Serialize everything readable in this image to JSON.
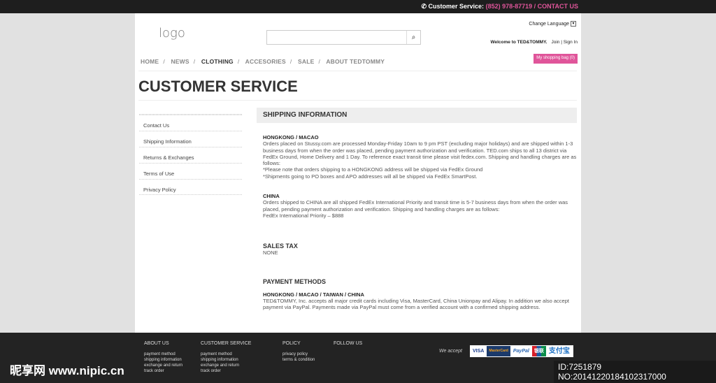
{
  "topbar": {
    "label": "Customer Service:",
    "phone": "(852) 978-87719",
    "sep": " / ",
    "contact": "CONTACT US"
  },
  "header": {
    "logo": "logo",
    "search_placeholder": "",
    "change_language": "Change Language",
    "welcome": "Welcome to TED&TOMMY.",
    "join": "Join",
    "sign_in": "Sign In",
    "bag": "My shopping bag (0)"
  },
  "nav": [
    "HOME",
    "NEWS",
    "CLOTHING",
    "ACCESORIES",
    "SALE",
    "ABOUT TEDTOMMY"
  ],
  "page_title": "CUSTOMER SERVICE",
  "sidebar": [
    "Contact Us",
    "Shipping Information",
    "Returns & Exchanges",
    "Terms of Use",
    "Privacy Policy"
  ],
  "content": {
    "heading": "SHIPPING INFORMATION",
    "hk_title": "HONGKONG / MACAO",
    "hk_text": "Orders placed on Stussy.com are processed Monday-Friday 10am to 9 pm PST (excluding major holidays) and are shipped within 1-3 business days from when the order was placed, pending payment authorization and verification. TED.com ships to all 13 district via FedEx Ground, Home Delivery and 1 Day. To reference exact transit time please visit fedex.com. Shipping and handling charges are as follows:",
    "hk_note1": "*Please note that orders shipping to a HONGKONG address will be shipped via FedEx Ground",
    "hk_note2": "*Shipments going to PO boxes and APO addresses will all be shipped via FedEx SmartPost.",
    "cn_title": "CHINA",
    "cn_text": "Orders shipped to CHINA are all shipped FedEx International Priority and transit time is 5-7 business days from when the order was placed, pending payment authorization and verification. Shipping and handling charges are as follows:",
    "cn_price": "FedEx International Priority – $888",
    "tax_title": "SALES TAX",
    "tax_text": "NONE",
    "pay_title": "PAYMENT METHODS",
    "pay_sub": "HONGKONG / MACAO / TAIWAN / CHINA",
    "pay_text": "TED&TOMMY, Inc. accepts all major credit cards including Visa, MasterCard, China Unionpay and Alipay. In addition we also accept payment via PayPal. Payments made via PayPal must come from a verified account with a confirmed shipping address."
  },
  "footer": {
    "cols": [
      {
        "title": "ABOUT US",
        "links": [
          "payment method",
          "shipping information",
          "exchange and return",
          "track order"
        ]
      },
      {
        "title": "CUSTOMER SERVICE",
        "links": [
          "payment method",
          "shipping information",
          "exchange and return",
          "track order"
        ]
      },
      {
        "title": "POLICY",
        "links": [
          "privacy policy",
          "terms & condition"
        ]
      },
      {
        "title": "FOLLOW US",
        "links": []
      }
    ],
    "we_accept": "We accept",
    "cards": [
      "VISA",
      "MasterCard",
      "PayPal",
      "银联",
      "支付宝"
    ]
  },
  "watermark": {
    "site": "昵享网 www.nipic.cn",
    "id": "ID:7251879 NO:20141220184102317000"
  },
  "colors": {
    "accent": "#e0559a",
    "topbar": "#1e1e1e",
    "footer": "#232323"
  }
}
